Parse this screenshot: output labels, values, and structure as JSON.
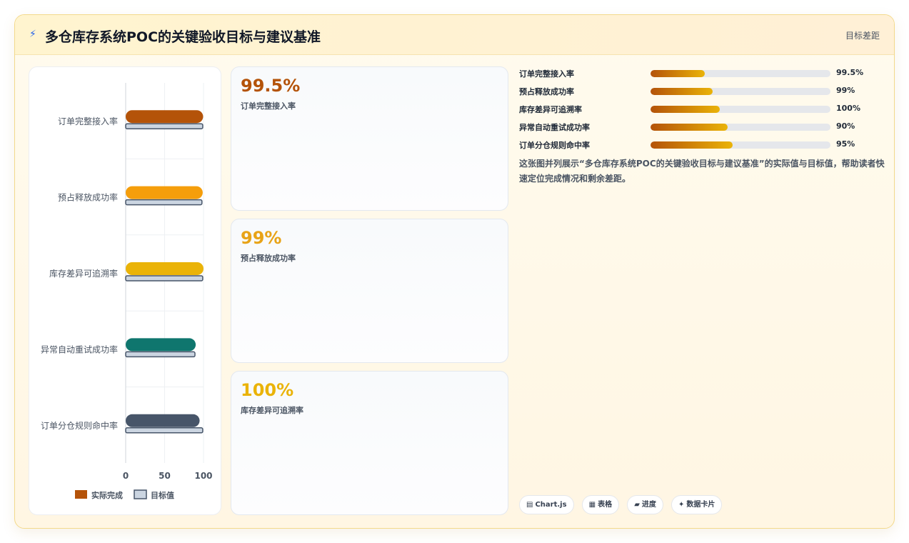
{
  "header": {
    "title": "多仓库存系统POC的关键验收目标与建议基准",
    "tag": "目标差距"
  },
  "icons": {
    "title_icon": "lightning-icon",
    "pills": [
      "chart-icon",
      "table-icon",
      "progress-icon",
      "sparkle-icon"
    ]
  },
  "colors": {
    "series_actual": [
      "#b45309",
      "#f59e0b",
      "#eab308",
      "#0f766e",
      "#475569"
    ],
    "series_target": "#cbd5e1",
    "target_border": "#475569",
    "kpi_values": [
      "#b45309",
      "#e8a317",
      "#eab308"
    ]
  },
  "chart_data": {
    "type": "bar",
    "orientation": "horizontal",
    "categories": [
      "订单完整接入率",
      "预占释放成功率",
      "库存差异可追溯率",
      "异常自动重试成功率",
      "订单分仓规则命中率"
    ],
    "series": [
      {
        "name": "实际完成",
        "values": [
          99.5,
          99,
          100,
          90,
          95
        ]
      },
      {
        "name": "目标值",
        "values": [
          99,
          98,
          99,
          89,
          99
        ]
      }
    ],
    "xlim": [
      0,
      100
    ],
    "xticks": [
      0,
      50,
      100
    ],
    "grid": true,
    "legend": "bottom"
  },
  "kpis": [
    {
      "value": "99.5%",
      "label": "订单完整接入率"
    },
    {
      "value": "99%",
      "label": "预占释放成功率"
    },
    {
      "value": "100%",
      "label": "库存差异可追溯率"
    }
  ],
  "progress": [
    {
      "label": "订单完整接入率",
      "pct": "99.5%",
      "fill": 0.3
    },
    {
      "label": "预占释放成功率",
      "pct": "99%",
      "fill": 0.345
    },
    {
      "label": "库存差异可追溯率",
      "pct": "100%",
      "fill": 0.385
    },
    {
      "label": "异常自动重试成功率",
      "pct": "90%",
      "fill": 0.43
    },
    {
      "label": "订单分仓规则命中率",
      "pct": "95%",
      "fill": 0.455
    }
  ],
  "description": "这张图并列展示“多仓库存系统POC的关键验收目标与建议基准”的实际值与目标值，帮助读者快速定位完成情况和剩余差距。",
  "pills": [
    {
      "icon": "▤",
      "label": "Chart.js"
    },
    {
      "icon": "▦",
      "label": "表格"
    },
    {
      "icon": "▰",
      "label": "进度"
    },
    {
      "icon": "✦",
      "label": "数据卡片"
    }
  ]
}
